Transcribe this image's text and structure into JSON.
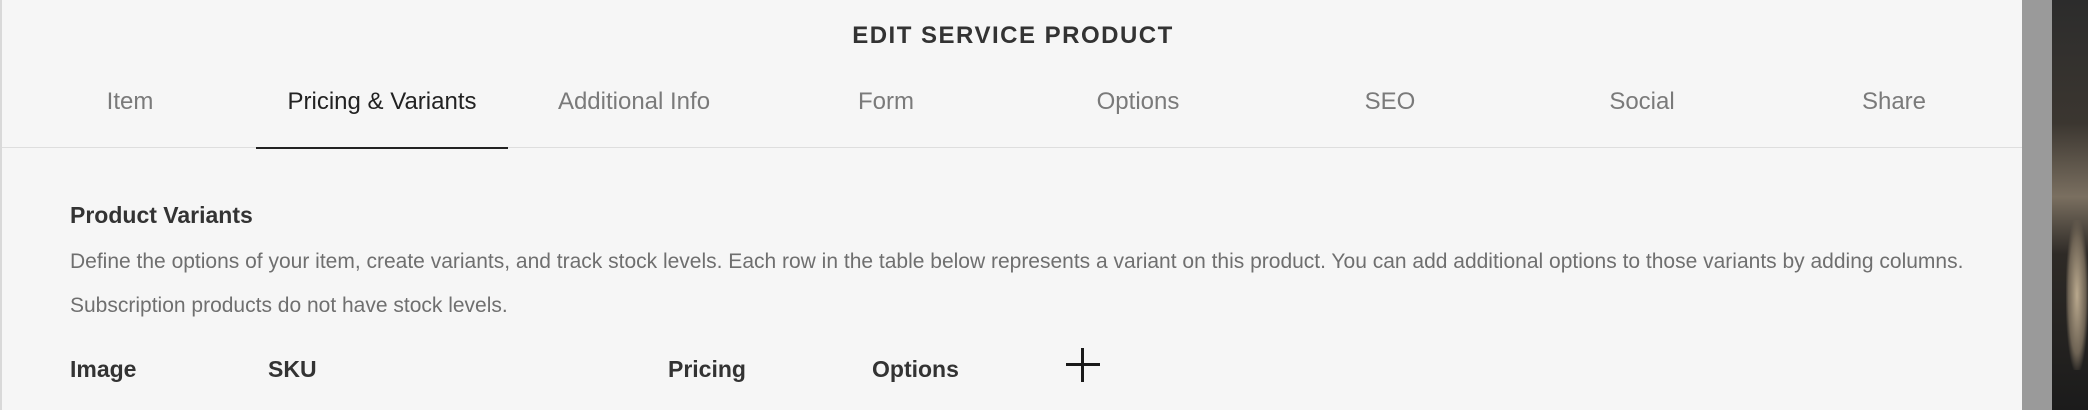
{
  "dialog": {
    "title": "EDIT SERVICE PRODUCT"
  },
  "tabs": [
    {
      "label": "Item",
      "active": false
    },
    {
      "label": "Pricing & Variants",
      "active": true
    },
    {
      "label": "Additional Info",
      "active": false
    },
    {
      "label": "Form",
      "active": false
    },
    {
      "label": "Options",
      "active": false
    },
    {
      "label": "SEO",
      "active": false
    },
    {
      "label": "Social",
      "active": false
    },
    {
      "label": "Share",
      "active": false
    }
  ],
  "variants": {
    "heading": "Product Variants",
    "description": "Define the options of your item, create variants, and track stock levels. Each row in the table below represents a variant on this product. You can add additional options to those variants by adding columns. Subscription products do not have stock levels.",
    "columns": [
      "Image",
      "SKU",
      "Pricing",
      "Options"
    ],
    "add_column_icon": "plus-icon"
  }
}
